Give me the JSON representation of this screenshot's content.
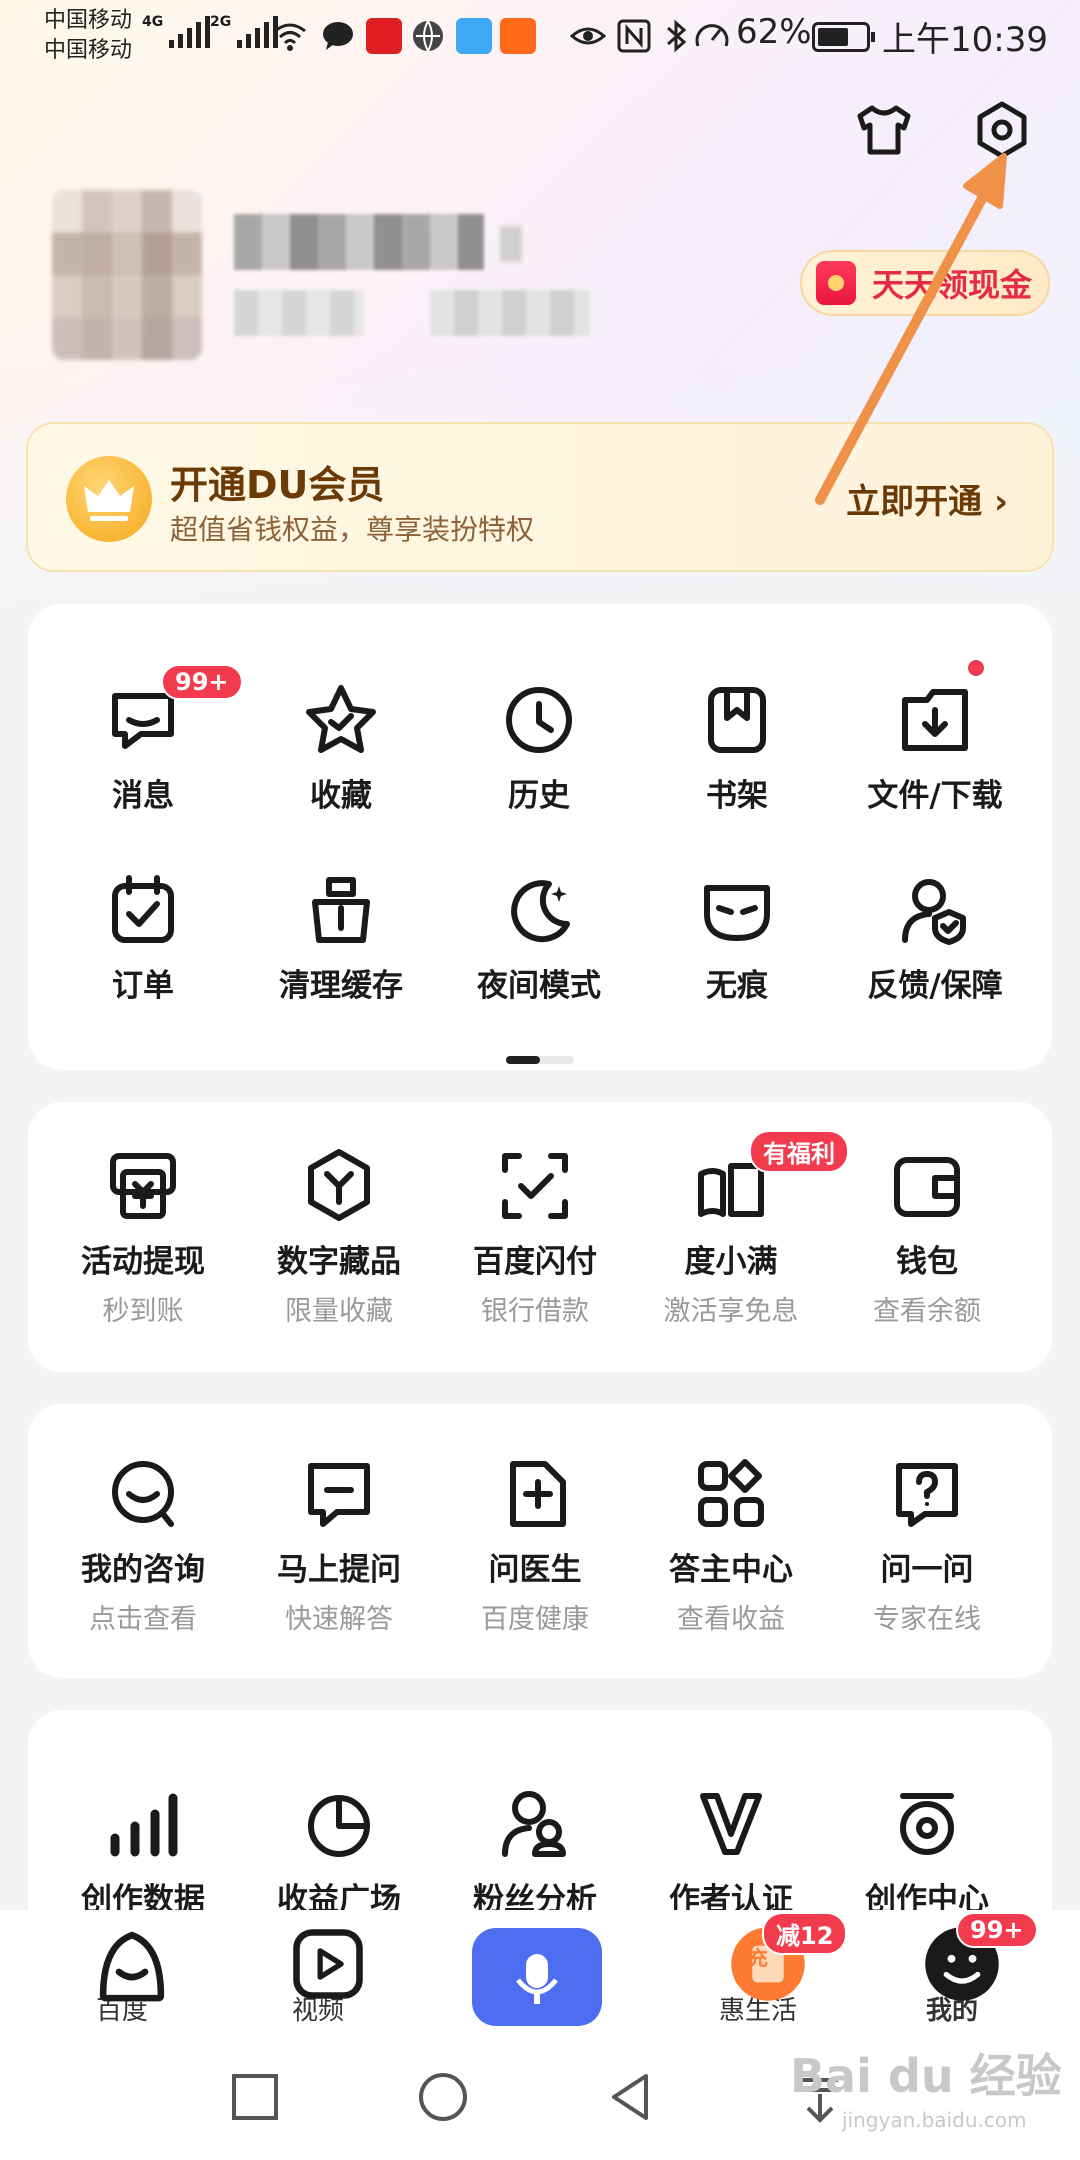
{
  "status_bar": {
    "carrier1": "中国移动",
    "carrier2": "中国移动",
    "sig1_tag": "4G",
    "sig2_tag": "2G",
    "battery": "62%",
    "time": "上午10:39"
  },
  "header": {
    "cash_label": "天天领现金"
  },
  "vip": {
    "title": "开通DU会员",
    "subtitle": "超值省钱权益，尊享装扮特权",
    "button": "立即开通 ›"
  },
  "tools": [
    {
      "label": "消息",
      "icon": "message-icon",
      "badge": "99+"
    },
    {
      "label": "收藏",
      "icon": "star-icon"
    },
    {
      "label": "历史",
      "icon": "clock-icon"
    },
    {
      "label": "书架",
      "icon": "bookshelf-icon"
    },
    {
      "label": "文件/下载",
      "icon": "folder-download-icon"
    },
    {
      "label": "订单",
      "icon": "order-icon"
    },
    {
      "label": "清理缓存",
      "icon": "clean-cache-icon"
    },
    {
      "label": "夜间模式",
      "icon": "moon-icon"
    },
    {
      "label": "无痕",
      "icon": "mask-icon"
    },
    {
      "label": "反馈/保障",
      "icon": "feedback-icon"
    }
  ],
  "finance": [
    {
      "label": "活动提现",
      "sub": "秒到账",
      "icon": "withdraw-icon"
    },
    {
      "label": "数字藏品",
      "sub": "限量收藏",
      "icon": "collectible-icon"
    },
    {
      "label": "百度闪付",
      "sub": "银行借款",
      "icon": "flash-pay-icon"
    },
    {
      "label": "度小满",
      "sub": "激活享免息",
      "icon": "duxiaoman-icon",
      "badge": "有福利"
    },
    {
      "label": "钱包",
      "sub": "查看余额",
      "icon": "wallet-icon"
    }
  ],
  "consult": [
    {
      "label": "我的咨询",
      "sub": "点击查看",
      "icon": "consult-icon"
    },
    {
      "label": "马上提问",
      "sub": "快速解答",
      "icon": "ask-icon"
    },
    {
      "label": "问医生",
      "sub": "百度健康",
      "icon": "doctor-icon"
    },
    {
      "label": "答主中心",
      "sub": "查看收益",
      "icon": "apps-icon"
    },
    {
      "label": "问一问",
      "sub": "专家在线",
      "icon": "question-icon"
    }
  ],
  "creator": [
    {
      "label": "创作数据",
      "icon": "bar-chart-icon"
    },
    {
      "label": "收益广场",
      "icon": "pie-chart-icon"
    },
    {
      "label": "粉丝分析",
      "icon": "fans-icon"
    },
    {
      "label": "作者认证",
      "icon": "verify-icon"
    },
    {
      "label": "创作中心",
      "icon": "creator-center-icon"
    }
  ],
  "bottom_nav": [
    {
      "label": "百度",
      "icon": "baidu-icon"
    },
    {
      "label": "视频",
      "icon": "video-icon"
    },
    {
      "label": "",
      "icon": "mic-icon"
    },
    {
      "label": "惠生活",
      "icon": "life-icon",
      "badge": "减12",
      "icon_text": "充"
    },
    {
      "label": "我的",
      "icon": "profile-icon",
      "badge": "99+"
    }
  ],
  "watermark": {
    "text": "Bai du 经验",
    "url": "jingyan.baidu.com"
  },
  "colors": {
    "accent": "#4e6ef2",
    "badge_red": "#f23b4d",
    "vip_brown": "#6b3b07",
    "annotation_orange": "#f0914a"
  }
}
